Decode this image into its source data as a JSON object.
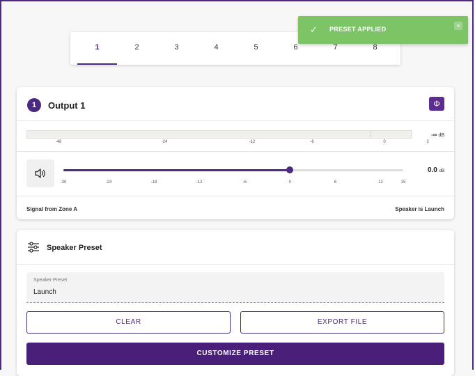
{
  "tabs": [
    "1",
    "2",
    "3",
    "4",
    "5",
    "6",
    "7",
    "8"
  ],
  "active_tab": "1",
  "toast": {
    "message": "PRESET APPLIED",
    "close": "×"
  },
  "output": {
    "number": "1",
    "title": "Output 1",
    "meter_ticks": [
      "-48",
      "-24",
      "-12",
      "-6",
      "0",
      "3"
    ],
    "meter_value": "-∞",
    "meter_unit": "dB",
    "slider_ticks": [
      "-30",
      "-24",
      "-18",
      "-12",
      "-6",
      "0",
      "6",
      "12",
      "15"
    ],
    "gain_value": 0.0,
    "gain_text": "0.0",
    "gain_unit": "dB",
    "gain_min": -30,
    "gain_max": 15,
    "signal_text": "Signal from Zone A",
    "speaker_text": "Speaker is Launch"
  },
  "preset": {
    "title": "Speaker Preset",
    "field_label": "Speaker Preset",
    "field_value": "Launch",
    "clear_label": "CLEAR",
    "export_label": "EXPORT FILE",
    "customize_label": "CUSTOMIZE PRESET"
  },
  "colors": {
    "accent": "#4a2a80",
    "toast": "#7cc466"
  },
  "icons": [
    "check-icon",
    "close-icon",
    "phase-icon",
    "speaker-icon",
    "sliders-icon"
  ]
}
